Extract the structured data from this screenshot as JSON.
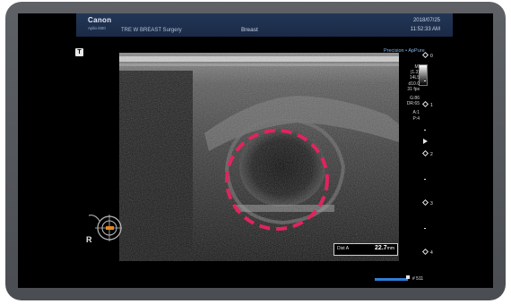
{
  "header": {
    "brand": "Canon",
    "model": "Aplio i800",
    "patient": "TRE W BREAST Surgery",
    "exam": "Breast",
    "date": "2018/07/25",
    "time": "11:52:33 AM"
  },
  "modes": {
    "precision": "Precision",
    "apure": "ApPure",
    "separator": "•"
  },
  "params": {
    "mi": "MI",
    "mi_val": "(1.3)",
    "probe": "14L5",
    "depth": "d10.0",
    "fps": "31 fps",
    "gain": "G:86",
    "dr": "DR:65",
    "a": "A:1",
    "p": "P:4"
  },
  "scale_ticks": [
    "0",
    "",
    "1",
    "",
    "2",
    "",
    "3",
    "",
    "4"
  ],
  "measurement": {
    "label": "Dist A",
    "value": "22.7",
    "unit": "mm"
  },
  "orientation": {
    "r_label": "R",
    "t_label": "T"
  },
  "frame": {
    "number": "# 511"
  },
  "colors": {
    "caliper_circle": "#e0245e",
    "header_bg": "#1f3150",
    "accent_blue": "#2f7ed8"
  }
}
